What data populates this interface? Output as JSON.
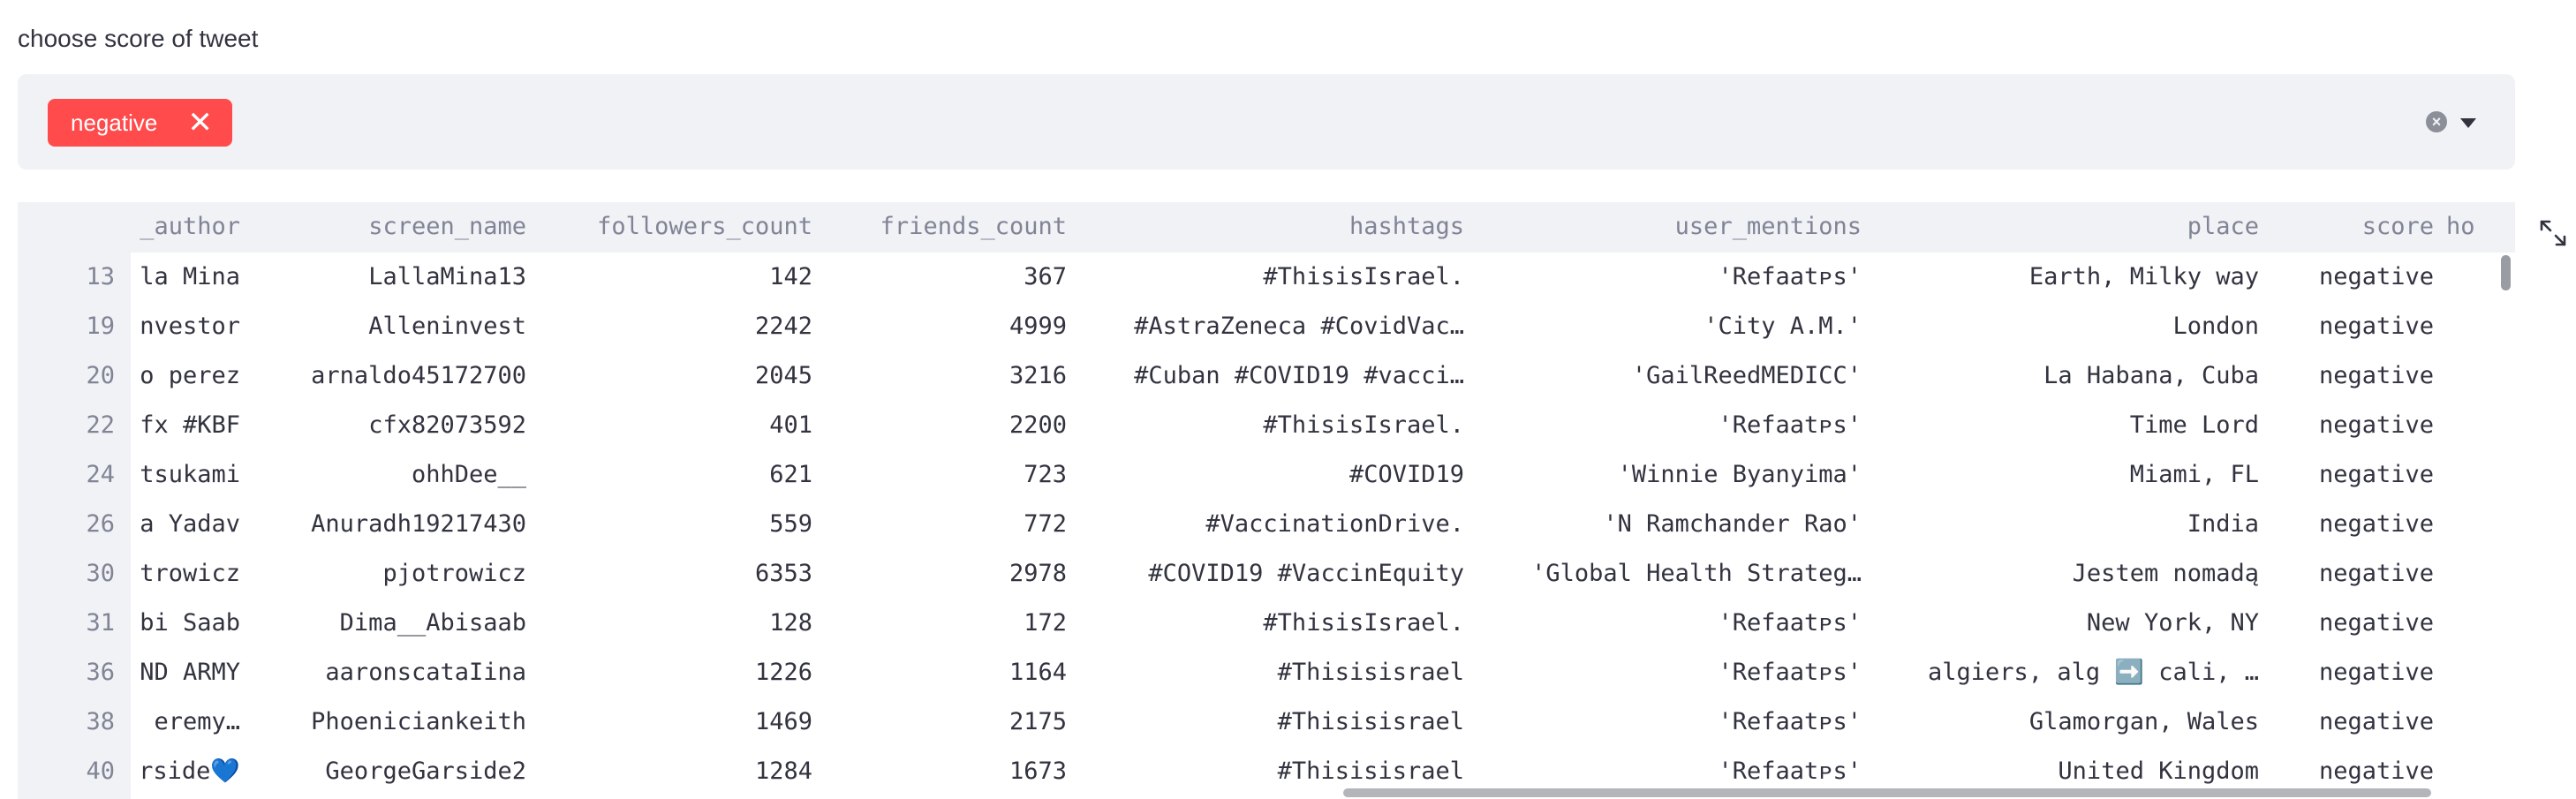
{
  "filter": {
    "label": "choose score of tweet",
    "selected": [
      "negative"
    ],
    "remove_glyph": "✕",
    "clear_glyph": "×"
  },
  "table": {
    "columns": [
      "_author",
      "screen_name",
      "followers_count",
      "friends_count",
      "hashtags",
      "user_mentions",
      "place",
      "score",
      "ho"
    ],
    "rows": [
      {
        "idx": "13",
        "cells": [
          "la Mina",
          "LallaMina13",
          "142",
          "367",
          "#ThisisIsrael.",
          "'Refaatᴘs'",
          "Earth, Milky way",
          "negative",
          ""
        ]
      },
      {
        "idx": "19",
        "cells": [
          "nvestor",
          "Alleninvest",
          "2242",
          "4999",
          "#AstraZeneca #CovidVac…",
          "'City A.M.'",
          "London",
          "negative",
          ""
        ]
      },
      {
        "idx": "20",
        "cells": [
          "o perez",
          "arnaldo45172700",
          "2045",
          "3216",
          "#Cuban #COVID19 #vacci…",
          "'GailReedMEDICC'",
          "La Habana, Cuba",
          "negative",
          ""
        ]
      },
      {
        "idx": "22",
        "cells": [
          "fx #KBF",
          "cfx82073592",
          "401",
          "2200",
          "#ThisisIsrael.",
          "'Refaatᴘs'",
          "Time Lord",
          "negative",
          ""
        ]
      },
      {
        "idx": "24",
        "cells": [
          "tsukami",
          "ohhDee__",
          "621",
          "723",
          "#COVID19",
          "'Winnie Byanyima'",
          "Miami, FL",
          "negative",
          ""
        ]
      },
      {
        "idx": "26",
        "cells": [
          "a Yadav",
          "Anuradh19217430",
          "559",
          "772",
          "#VaccinationDrive.",
          "'N Ramchander Rao'",
          "India",
          "negative",
          ""
        ]
      },
      {
        "idx": "30",
        "cells": [
          "trowicz",
          "pjotrowicz",
          "6353",
          "2978",
          "#COVID19 #VaccinEquity",
          "'Global Health Strateg…",
          "Jestem nomadą",
          "negative",
          ""
        ]
      },
      {
        "idx": "31",
        "cells": [
          "bi Saab",
          "Dima__Abisaab",
          "128",
          "172",
          "#ThisisIsrael.",
          "'Refaatᴘs'",
          "New York, NY",
          "negative",
          ""
        ]
      },
      {
        "idx": "36",
        "cells": [
          "ND ARMY",
          "aaronscataIina",
          "1226",
          "1164",
          "#Thisisisrael",
          "'Refaatᴘs'",
          "algiers, alg ➡️ cali, …",
          "negative",
          ""
        ]
      },
      {
        "idx": "38",
        "cells": [
          "eremy…",
          "Phoeniciankeith",
          "1469",
          "2175",
          "#Thisisisrael",
          "'Refaatᴘs'",
          "Glamorgan, Wales",
          "negative",
          ""
        ]
      },
      {
        "idx": "40",
        "cells": [
          "rside💙",
          "GeorgeGarside2",
          "1284",
          "1673",
          "#Thisisisrael",
          "'Refaatᴘs'",
          "United Kingdom",
          "negative",
          ""
        ]
      }
    ]
  },
  "colors": {
    "chip": "#ff4b4b",
    "panel": "#f0f2f6",
    "text": "#31333f",
    "muted": "#808495"
  },
  "icons": [
    "close-icon",
    "clear-icon",
    "chevron-down-icon",
    "expand-icon"
  ]
}
